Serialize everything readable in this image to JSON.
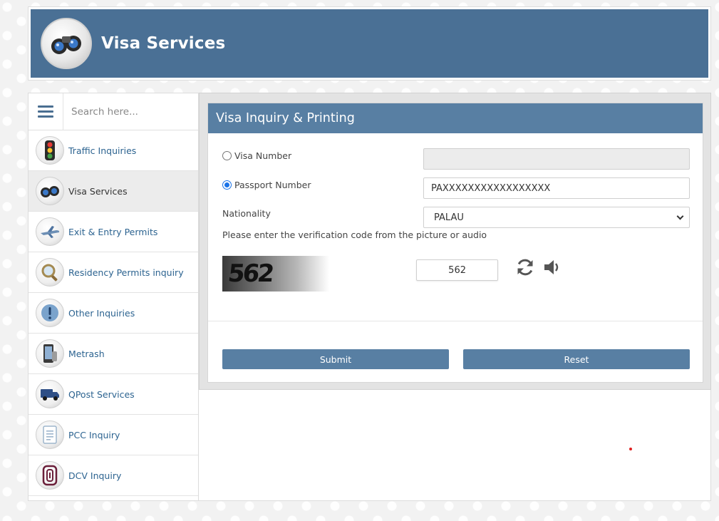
{
  "header": {
    "title": "Visa Services",
    "logo_icon": "binoculars-icon"
  },
  "sidebar": {
    "search_placeholder": "Search here...",
    "items": [
      {
        "label": "Traffic Inquiries",
        "icon": "traffic-light-icon",
        "active": false
      },
      {
        "label": "Visa Services",
        "icon": "binoculars-icon",
        "active": true
      },
      {
        "label": "Exit & Entry Permits",
        "icon": "airplane-icon",
        "active": false
      },
      {
        "label": "Residency Permits inquiry",
        "icon": "magnifier-icon",
        "active": false
      },
      {
        "label": "Other Inquiries",
        "icon": "exclamation-icon",
        "active": false
      },
      {
        "label": "Metrash",
        "icon": "phone-icon",
        "active": false
      },
      {
        "label": "QPost Services",
        "icon": "delivery-truck-icon",
        "active": false
      },
      {
        "label": "PCC Inquiry",
        "icon": "certificate-icon",
        "active": false
      },
      {
        "label": "DCV Inquiry",
        "icon": "dcv-logo-icon",
        "active": false
      }
    ]
  },
  "form": {
    "title": "Visa Inquiry & Printing",
    "visa_number": {
      "label": "Visa Number",
      "value": "",
      "checked": false
    },
    "passport_number": {
      "label": "Passport Number",
      "value": "PAXXXXXXXXXXXXXXXXX",
      "checked": true
    },
    "nationality": {
      "label": "Nationality",
      "value": "PALAU"
    },
    "hint": "Please enter the verification code from the picture or audio",
    "captcha": {
      "image_text": "562",
      "input_value": "562"
    },
    "submit_label": "Submit",
    "reset_label": "Reset"
  },
  "colors": {
    "header_bg": "#4a7095",
    "panel_head": "#587fa3",
    "link": "#2c6390",
    "radio_checked": "#1a73e8"
  }
}
